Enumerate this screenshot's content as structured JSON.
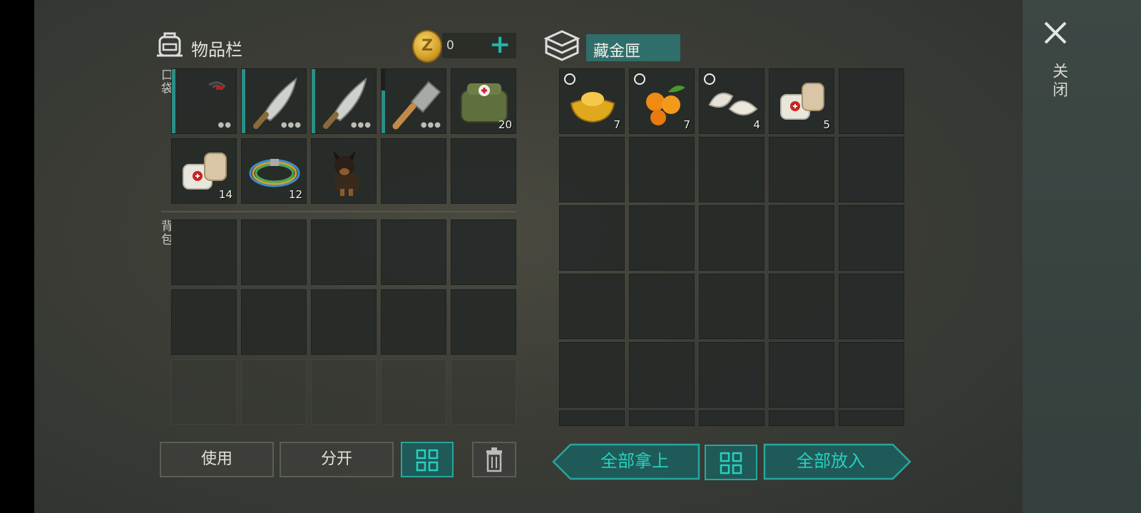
{
  "inventory": {
    "title": "物品栏",
    "coins": "0",
    "plus_label": "+",
    "pocket_label": "口袋",
    "backpack_label": "背包",
    "pocket_slots": [
      {
        "item": "crowbar",
        "count": "",
        "durability": true
      },
      {
        "item": "machete",
        "count": "",
        "durability": true
      },
      {
        "item": "machete",
        "count": "",
        "durability": true
      },
      {
        "item": "cleaver",
        "count": "",
        "durability": true
      },
      {
        "item": "medical-bag",
        "count": "20"
      },
      {
        "item": "bandage",
        "count": "14"
      },
      {
        "item": "wire",
        "count": "12"
      },
      {
        "item": "puppy",
        "count": ""
      },
      {
        "item": "",
        "count": ""
      },
      {
        "item": "",
        "count": ""
      }
    ]
  },
  "container": {
    "name": "藏金匣",
    "slots": [
      {
        "item": "gold-ingot",
        "count": "7",
        "timer": true
      },
      {
        "item": "kumquats",
        "count": "7",
        "timer": true
      },
      {
        "item": "dumplings",
        "count": "4",
        "timer": true
      },
      {
        "item": "bandage",
        "count": "5"
      }
    ]
  },
  "buttons": {
    "use": "使用",
    "split": "分开",
    "take_all": "全部拿上",
    "put_all": "全部放入"
  },
  "close_label": "关闭",
  "colors": {
    "accent": "#27a79c",
    "accent_dark": "#1f5a58"
  }
}
